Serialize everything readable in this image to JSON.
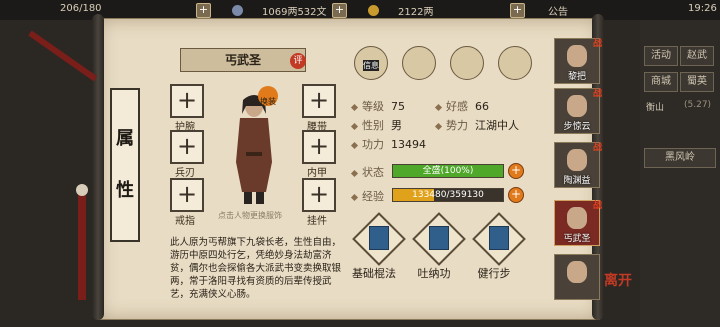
{
  "topbar": {
    "stamina": "206/180",
    "coins": "1069两532文",
    "gold": "2122两",
    "announcement": "公告",
    "time": "19:26"
  },
  "character": {
    "sect_vertical": [
      "丐",
      "帮"
    ],
    "name_vertical": [
      "属",
      "性"
    ],
    "title": "丐武圣",
    "rank_badge": "评",
    "change_badge": "换装",
    "hint": "点击人物更换服饰"
  },
  "slots": [
    {
      "label": "护腕"
    },
    {
      "label": "腰带"
    },
    {
      "label": "兵刃"
    },
    {
      "label": "内甲"
    },
    {
      "label": "戒指"
    },
    {
      "label": "挂件"
    }
  ],
  "equip_icons": [
    "helmet-icon",
    "gourd-icon",
    "amulet-icon",
    "fist-icon"
  ],
  "equip_first_label": "信息",
  "stats": {
    "level_label": "等级",
    "level": "75",
    "favor_label": "好感",
    "favor": "66",
    "gender_label": "性别",
    "gender": "男",
    "faction_label": "势力",
    "faction": "江湖中人",
    "power_label": "功力",
    "power": "13494",
    "status_label": "状态",
    "status_text": "全盛(100%)",
    "status_fraction": 1.0,
    "exp_label": "经验",
    "exp_text": "133480/359130",
    "exp_fraction": 0.372
  },
  "skills": [
    {
      "label": "基础棍法"
    },
    {
      "label": "吐纳功"
    },
    {
      "label": "健行步"
    }
  ],
  "description": "此人原为丐帮旗下九袋长老，生性自由，游历中原四处行乞，凭绝妙身法劫富济贫，偶尔也会探偷各大派武书变卖换取银两，常于洛阳寻找有资质的后辈传授武艺，充满侠义心肠。",
  "portraits": [
    {
      "name": "黎把",
      "selected": false
    },
    {
      "name": "步惊云",
      "selected": false
    },
    {
      "name": "陶渊益",
      "selected": false
    },
    {
      "name": "丐武圣",
      "selected": true
    },
    {
      "name": "",
      "selected": false
    }
  ],
  "right_menu": [
    "活动",
    "赵武",
    "商城",
    "蜀英"
  ],
  "right_location": "衡山",
  "right_location_sub": "(5.27)",
  "right_target": "黑风岭",
  "side_badge": "离开",
  "colors": {
    "status": "#4fa82a",
    "exp": "#e0a21a",
    "accent": "#c23a24"
  }
}
